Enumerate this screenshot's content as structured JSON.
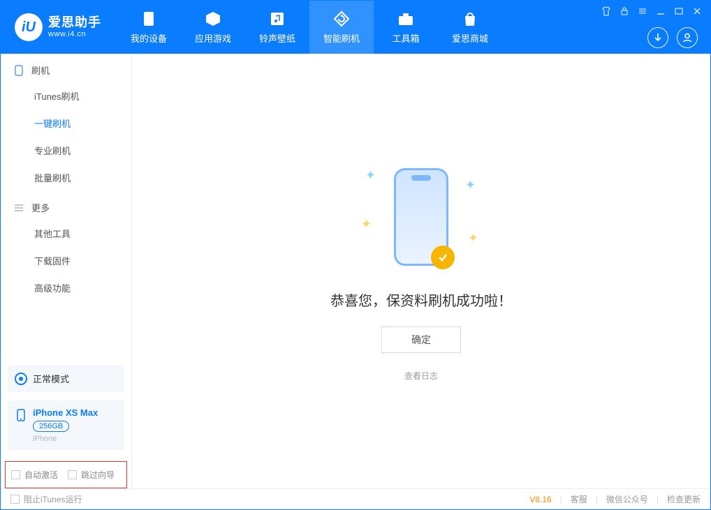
{
  "brand": {
    "name": "爱思助手",
    "url": "www.i4.cn"
  },
  "nav": {
    "device": "我的设备",
    "apps": "应用游戏",
    "ringtones": "铃声壁纸",
    "flash": "智能刷机",
    "toolbox": "工具箱",
    "store": "爱思商城"
  },
  "sidebar": {
    "group_flash": "刷机",
    "items_flash": {
      "itunes": "iTunes刷机",
      "oneclick": "一键刷机",
      "pro": "专业刷机",
      "batch": "批量刷机"
    },
    "group_more": "更多",
    "items_more": {
      "other": "其他工具",
      "firmware": "下载固件",
      "advanced": "高级功能"
    }
  },
  "device_mode": "正常模式",
  "device": {
    "name": "iPhone XS Max",
    "badge": "256GB",
    "type": "iPhone"
  },
  "bottom_highlight": {
    "auto_activate": "自动激活",
    "skip_guide": "跳过向导"
  },
  "main": {
    "title": "恭喜您，保资料刷机成功啦！",
    "ok": "确定",
    "view_log": "查看日志"
  },
  "footer": {
    "block_itunes": "阻止iTunes运行",
    "version": "V8.16",
    "support": "客服",
    "wechat": "微信公众号",
    "update": "检查更新"
  }
}
